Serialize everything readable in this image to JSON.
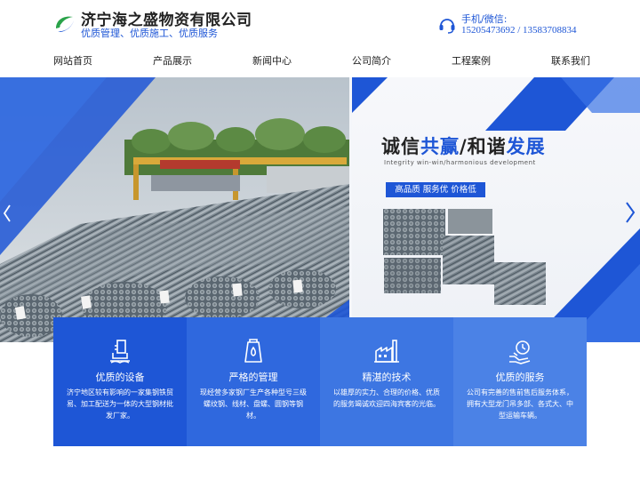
{
  "header": {
    "company_name": "济宁海之盛物资有限公司",
    "slogan": "优质管理、优质施工、优质服务",
    "contact_label": "手机/微信:",
    "contact_phones": "15205473692 / 13583708834"
  },
  "nav": {
    "items": [
      {
        "label": "网站首页"
      },
      {
        "label": "产品展示"
      },
      {
        "label": "新闻中心"
      },
      {
        "label": "公司简介"
      },
      {
        "label": "工程案例"
      },
      {
        "label": "联系我们"
      }
    ]
  },
  "banner": {
    "headline_part1": "诚信",
    "headline_part2": "共赢",
    "headline_part3": "/和谐",
    "headline_part4": "发展",
    "headline_en": "Integrity win-win/harmonious development",
    "tagline": "高品质 服务优 价格低"
  },
  "features": [
    {
      "title": "优质的设备",
      "desc": "济宁地区较有影响的一家集钢铁贸易、加工配送为一体的大型钢材批发厂家。",
      "icon": "equipment-icon",
      "color": "#1e56d6"
    },
    {
      "title": "严格的管理",
      "desc": "现经营多家钢厂生产各种型号三级螺纹钢、线材、盘螺、圆钢等钢材。",
      "icon": "management-icon",
      "color": "#2f68de"
    },
    {
      "title": "精湛的技术",
      "desc": "以雄厚的实力、合理的价格、优质的服务竭诚欢迎四海宾客的光临。",
      "icon": "factory-icon",
      "color": "#3d76e2"
    },
    {
      "title": "优质的服务",
      "desc": "公司有完善的售前售后服务体系，拥有大型龙门吊多部、各式大、中型运输车辆。",
      "icon": "service-icon",
      "color": "#4b82e6"
    }
  ],
  "colors": {
    "brand_blue": "#1e56d6"
  }
}
